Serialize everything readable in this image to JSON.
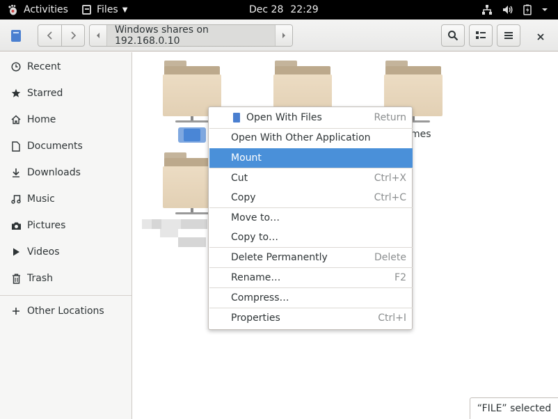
{
  "topbar": {
    "activities": "Activities",
    "app_name": "Files",
    "date": "Dec 28",
    "time": "22:29"
  },
  "headerbar": {
    "location": "Windows shares on 192.168.0.10"
  },
  "sidebar": {
    "items": [
      {
        "label": "Recent",
        "icon": "clock-icon"
      },
      {
        "label": "Starred",
        "icon": "star-icon"
      },
      {
        "label": "Home",
        "icon": "home-icon"
      },
      {
        "label": "Documents",
        "icon": "document-icon"
      },
      {
        "label": "Downloads",
        "icon": "download-icon"
      },
      {
        "label": "Music",
        "icon": "music-icon"
      },
      {
        "label": "Pictures",
        "icon": "camera-icon"
      },
      {
        "label": "Videos",
        "icon": "video-icon"
      },
      {
        "label": "Trash",
        "icon": "trash-icon"
      }
    ],
    "other_locations": "Other Locations"
  },
  "main": {
    "folder3_label_partial": "mes"
  },
  "context_menu": {
    "items": [
      {
        "label": "Open With Files",
        "accel": "Return"
      },
      {
        "label": "Open With Other Application",
        "accel": ""
      },
      {
        "label": "Mount",
        "accel": ""
      },
      {
        "label": "Cut",
        "accel": "Ctrl+X"
      },
      {
        "label": "Copy",
        "accel": "Ctrl+C"
      },
      {
        "label": "Move to…",
        "accel": ""
      },
      {
        "label": "Copy to…",
        "accel": ""
      },
      {
        "label": "Delete Permanently",
        "accel": "Delete"
      },
      {
        "label": "Rename…",
        "accel": "F2"
      },
      {
        "label": "Compress…",
        "accel": ""
      },
      {
        "label": "Properties",
        "accel": "Ctrl+I"
      }
    ]
  },
  "status": {
    "text": "“FILE” selected"
  },
  "colors": {
    "highlight": "#4a90d9",
    "topbar": "#000000",
    "folder": "#e2d0b4"
  }
}
